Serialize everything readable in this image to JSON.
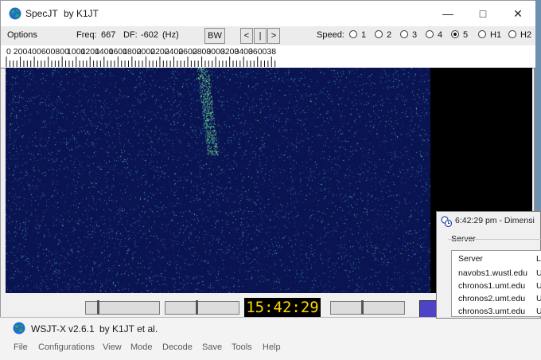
{
  "specjt": {
    "title": "SpecJT",
    "author": "by K1JT",
    "toolbar": {
      "options": "Options",
      "freq_label": "Freq:",
      "freq_value": "667",
      "df_label": "DF:",
      "df_value": "-602",
      "df_unit": "(Hz)",
      "bw_button": "BW",
      "nav_left": "<",
      "nav_mid": "|",
      "nav_right": ">",
      "speed_label": "Speed:",
      "speed_options": [
        "1",
        "2",
        "3",
        "4",
        "5",
        "H1",
        "H2"
      ],
      "speed_selected": "5"
    },
    "ruler_labels": [
      "0",
      "200",
      "400",
      "600",
      "800",
      "1000",
      "1200",
      "1400",
      "1600",
      "1800",
      "2000",
      "2200",
      "2400",
      "2600",
      "2800",
      "3000",
      "3200",
      "3400",
      "3600",
      "38"
    ],
    "clock": "15:42:29"
  },
  "wsjtx": {
    "title": "WSJT-X",
    "version": "v2.6.1",
    "author": "by K1JT et al.",
    "menu": [
      "File",
      "Configurations",
      "View",
      "Mode",
      "Decode",
      "Save",
      "Tools",
      "Help"
    ]
  },
  "dimension4": {
    "title": "6:42:29 pm - Dimensi",
    "server_group_label": "Server",
    "column_header": "Server",
    "column_header2": "L",
    "servers": [
      "navobs1.wustl.edu",
      "chronos1.umt.edu",
      "chronos2.umt.edu",
      "chronos3.umt.edu"
    ],
    "server_col2": [
      "U",
      "U",
      "U",
      "U"
    ]
  },
  "colors": {
    "waterfall_bg": "#0a1450",
    "clock_fg": "#ffd700",
    "clock_bg": "#000000",
    "purple_indicator": "#4d43c7"
  }
}
